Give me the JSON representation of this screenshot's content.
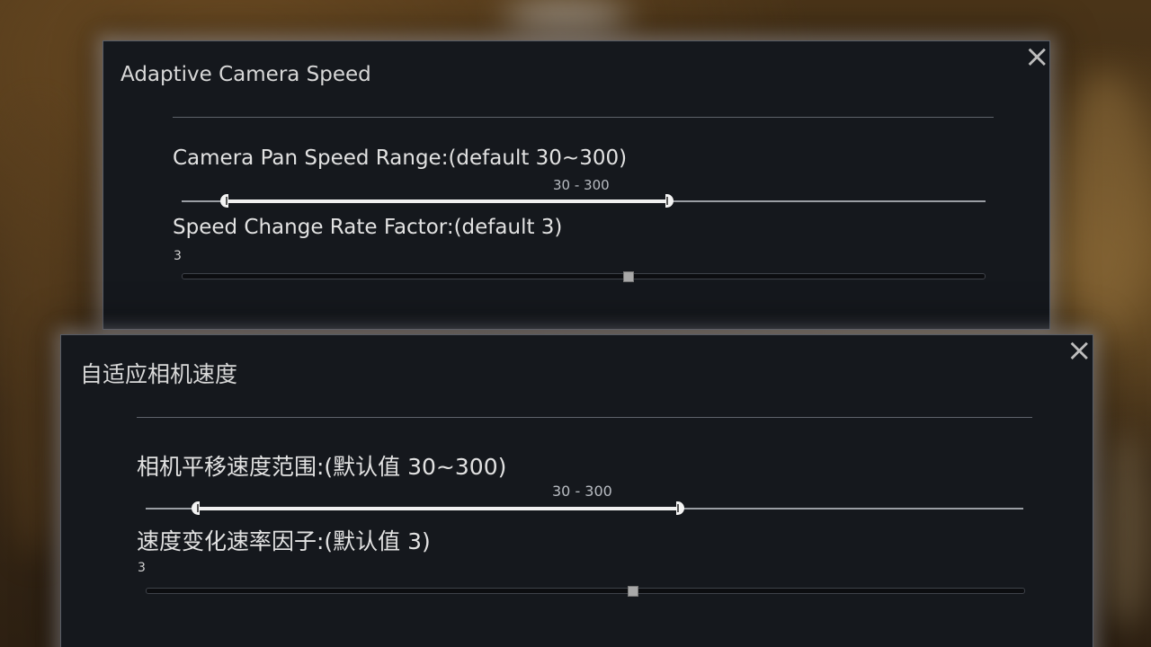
{
  "panel_en": {
    "title": "Adaptive Camera Speed",
    "pan_label": "Camera Pan Speed Range:(default 30~300)",
    "pan_range_value": "30 - 300",
    "pan_min": 30,
    "pan_max": 300,
    "rate_label": "Speed Change Rate Factor:(default 3)",
    "rate_value": "3",
    "close_icon": "×"
  },
  "panel_zh": {
    "title": "自适应相机速度",
    "pan_label": "相机平移速度范围:(默认值 30~300)",
    "pan_range_value": "30 - 300",
    "pan_min": 30,
    "pan_max": 300,
    "rate_label": "速度变化速率因子:(默认值 3)",
    "rate_value": "3",
    "close_icon": "×"
  },
  "colors": {
    "panel_bg": "#15181d",
    "text": "#e2e2e2",
    "slider_fill": "#f0f0f0"
  }
}
